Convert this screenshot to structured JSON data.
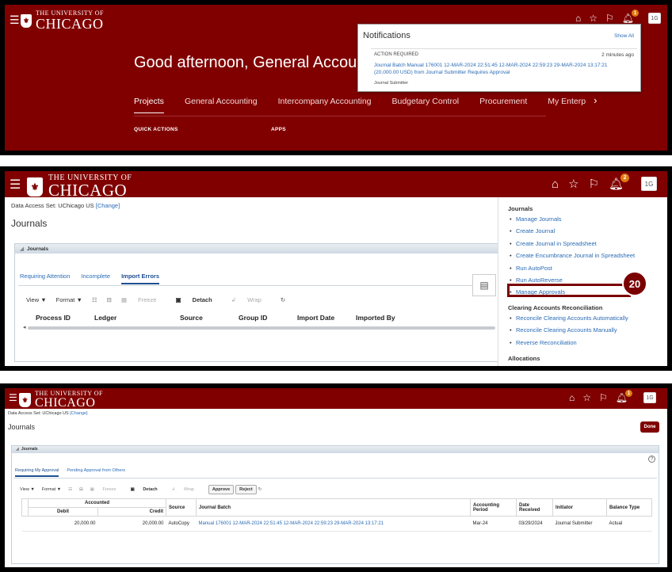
{
  "brand": {
    "small": "THE UNIVERSITY OF",
    "big": "CHICAGO"
  },
  "panel1": {
    "greeting": "Good afternoon, General Accountin",
    "tabs": [
      "Projects",
      "General Accounting",
      "Intercompany Accounting",
      "Budgetary Control",
      "Procurement",
      "My Enterp"
    ],
    "quick_actions": "QUICK ACTIONS",
    "apps": "APPS",
    "notif_badge": "1",
    "user": "1G",
    "notifications": {
      "title": "Notifications",
      "show_all": "Show All",
      "action": "ACTION REQUIRED",
      "time": "2 minutes ago",
      "body": "Journal Batch Manual 176001 12-MAR-2024 22:51:45 12-MAR-2024 22:59:23 29-MAR-2024 13:17:21 (20,000.00 USD) from Journal Submitter Requires Approval",
      "sub": "Journal Submitter"
    }
  },
  "panel2": {
    "notif_badge": "2",
    "user": "1G",
    "data_access_label": "Data Access Set: UChicago US",
    "change": "[Change]",
    "title": "Journals",
    "box_title": "Journals",
    "subtabs": [
      "Requiring Attention",
      "Incomplete",
      "Import Errors"
    ],
    "tools": {
      "view": "View ▼",
      "format": "Format ▼",
      "freeze": "Freeze",
      "detach": "Detach",
      "wrap": "Wrap"
    },
    "columns": [
      "Process ID",
      "Ledger",
      "Source",
      "Group ID",
      "Import Date",
      "Imported By"
    ],
    "side": {
      "journals_title": "Journals",
      "journals": [
        "Manage Journals",
        "Create Journal",
        "Create Journal in Spreadsheet",
        "Create Encumbrance Journal in Spreadsheet",
        "Run AutoPost",
        "Run AutoReverse",
        "Manage Approvals"
      ],
      "clearing_title": "Clearing Accounts Reconciliation",
      "clearing": [
        "Reconcile Clearing Accounts Automatically",
        "Reconcile Clearing Accounts Manually",
        "Reverse Reconciliation"
      ],
      "allocations_title": "Allocations"
    },
    "step": "20"
  },
  "panel3": {
    "notif_badge": "1",
    "user": "1G",
    "data_access_label": "Data Access Set: UChicago US",
    "change": "[Change]",
    "title": "Journals",
    "done": "Done",
    "box_title": "Journals",
    "subtabs": [
      "Requiring My Approval",
      "Pending Approval from Others"
    ],
    "tools": {
      "view": "View ▼",
      "format": "Format ▼",
      "freeze": "Freeze",
      "detach": "Detach",
      "wrap": "Wrap",
      "approve": "Approve",
      "reject": "Reject"
    },
    "headers": {
      "accounted": "Accounted",
      "debit": "Debit",
      "credit": "Credit",
      "source": "Source",
      "batch": "Journal Batch",
      "period": "Accounting Period",
      "date": "Date Received",
      "initiator": "Initiator",
      "balance": "Balance Type"
    },
    "row": {
      "debit": "20,000.00",
      "credit": "20,000.00",
      "source": "AutoCopy",
      "batch": "Manual 176001 12-MAR-2024 22:51:45 12-MAR-2024 22:59:23 29-MAR-2024 13:17:21",
      "period": "Mar-24",
      "date": "03/29/2024",
      "initiator": "Journal Submitter",
      "balance": "Actual"
    }
  },
  "colors": {
    "brand": "#800000",
    "link": "#2a6bb5",
    "badge": "#e07a10"
  }
}
